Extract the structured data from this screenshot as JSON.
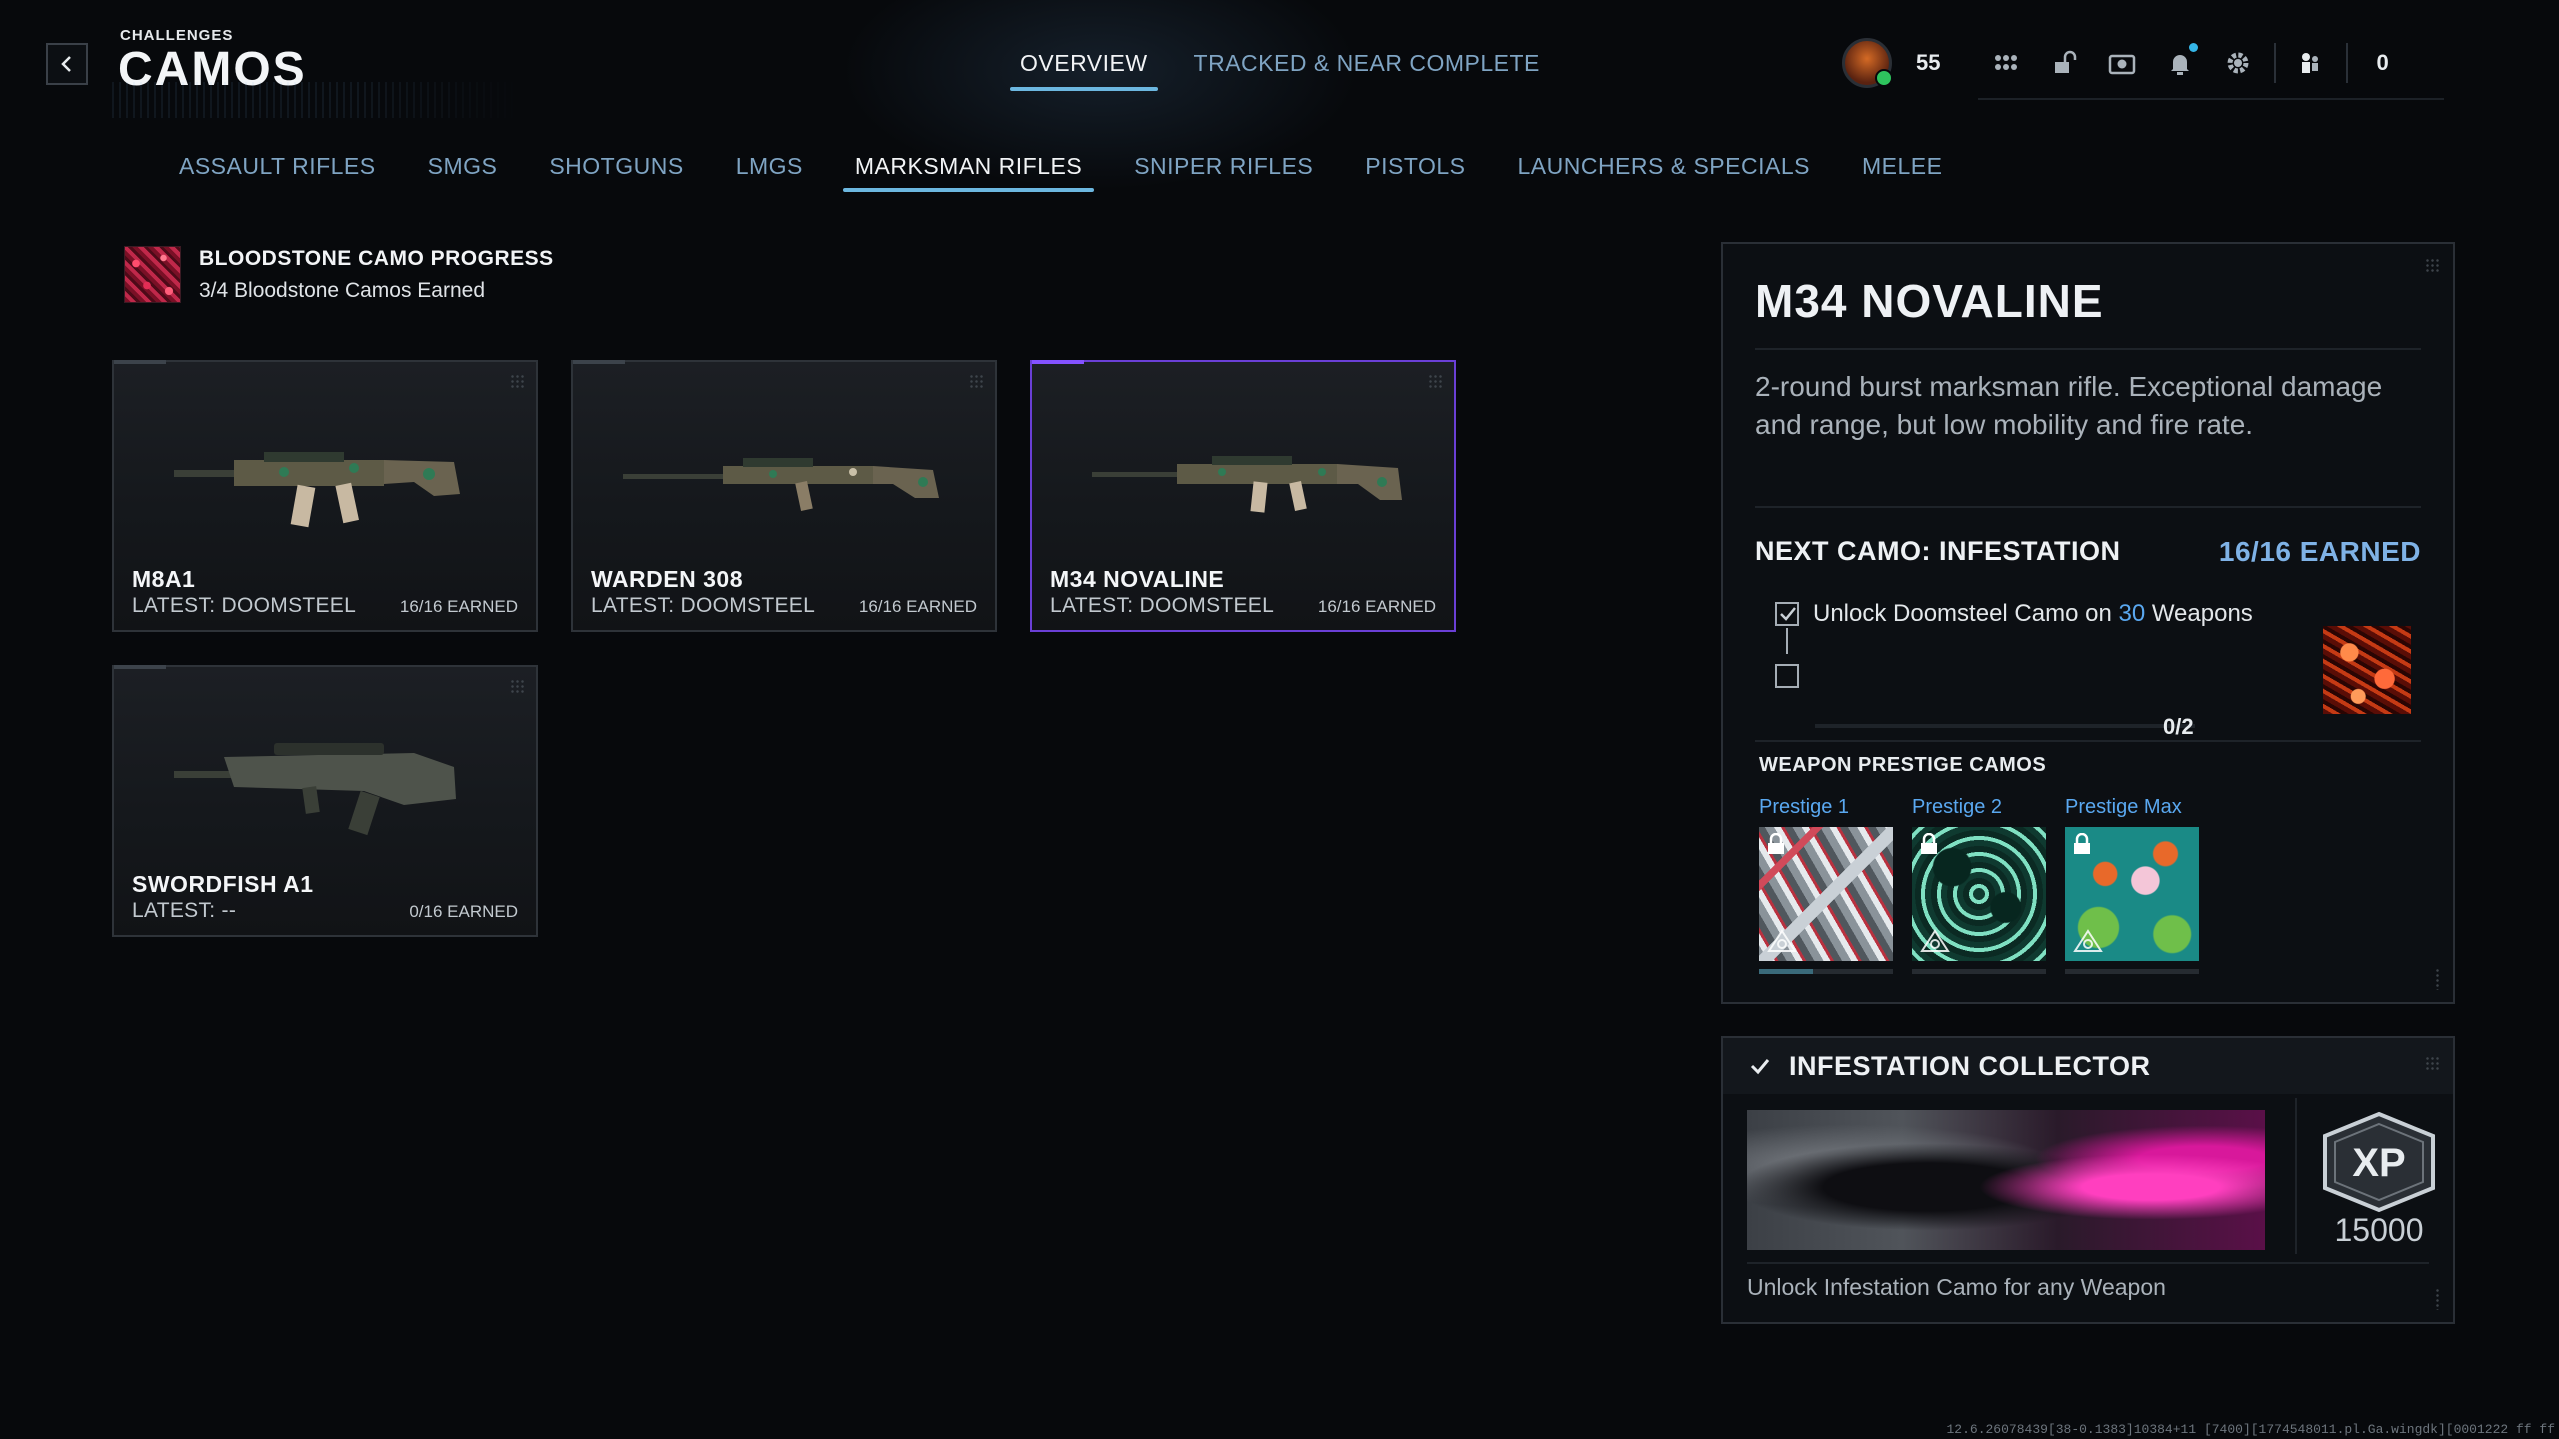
{
  "header": {
    "breadcrumb": "CHALLENGES",
    "title": "CAMOS",
    "top_tabs": [
      {
        "label": "OVERVIEW",
        "active": true
      },
      {
        "label": "TRACKED & NEAR COMPLETE",
        "active": false
      }
    ],
    "player_level": "55",
    "currency": "0",
    "icons": [
      "avatar",
      "apps-grid-icon",
      "unlock-icon",
      "camera-icon",
      "bell-icon",
      "gear-icon",
      "squad-icon"
    ]
  },
  "categories": [
    {
      "label": "ASSAULT RIFLES",
      "active": false
    },
    {
      "label": "SMGS",
      "active": false
    },
    {
      "label": "SHOTGUNS",
      "active": false
    },
    {
      "label": "LMGS",
      "active": false
    },
    {
      "label": "MARKSMAN RIFLES",
      "active": true
    },
    {
      "label": "SNIPER RIFLES",
      "active": false
    },
    {
      "label": "PISTOLS",
      "active": false
    },
    {
      "label": "LAUNCHERS & SPECIALS",
      "active": false
    },
    {
      "label": "MELEE",
      "active": false
    }
  ],
  "progress": {
    "title": "BLOODSTONE CAMO PROGRESS",
    "subtitle": "3/4 Bloodstone Camos Earned",
    "earned": 3,
    "total": 4
  },
  "weapons": [
    {
      "name": "M8A1",
      "latest": "LATEST: DOOMSTEEL",
      "earned": "16/16 EARNED",
      "selected": false
    },
    {
      "name": "WARDEN 308",
      "latest": "LATEST: DOOMSTEEL",
      "earned": "16/16 EARNED",
      "selected": false
    },
    {
      "name": "M34 NOVALINE",
      "latest": "LATEST: DOOMSTEEL",
      "earned": "16/16 EARNED",
      "selected": true
    },
    {
      "name": "SWORDFISH A1",
      "latest": "LATEST: --",
      "earned": "0/16 EARNED",
      "selected": false
    }
  ],
  "detail": {
    "title": "M34 NOVALINE",
    "description": "2-round burst marksman rifle. Exceptional damage and range, but low mobility and fire rate.",
    "next_camo_label": "NEXT CAMO: INFESTATION",
    "next_camo_earned": "16/16 EARNED",
    "challenge_prefix": "Unlock Doomsteel Camo on ",
    "challenge_count": "30",
    "challenge_suffix": " Weapons",
    "challenge_checked": true,
    "challenge2_checked": false,
    "mini_progress_label": "0/2",
    "mini_progress_fraction": 0,
    "prestige_title": "WEAPON PRESTIGE CAMOS",
    "prestige": [
      {
        "label": "Prestige 1",
        "locked": true,
        "progress": 0.4
      },
      {
        "label": "Prestige 2",
        "locked": true,
        "progress": 0
      },
      {
        "label": "Prestige Max",
        "locked": true,
        "progress": 0
      }
    ]
  },
  "collector": {
    "title": "INFESTATION COLLECTOR",
    "xp_label": "XP",
    "xp_value": "15000",
    "description": "Unlock Infestation Camo for any Weapon"
  },
  "build_id": "12.6.26078439[38-0.1383]10384+11 [7400][1774548011.pl.Ga.wingdk][0001222 ff ff"
}
